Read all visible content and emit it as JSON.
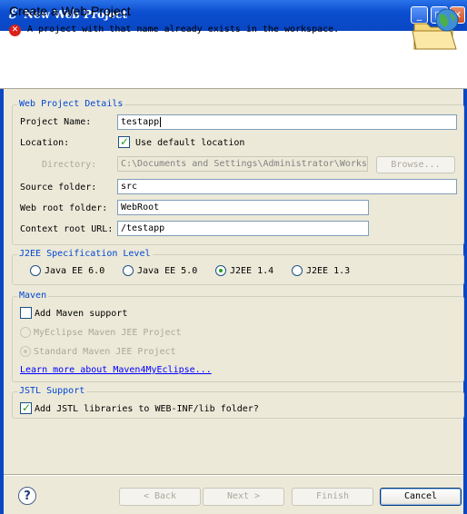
{
  "window": {
    "title": "New Web Project",
    "minimize_label": "_",
    "maximize_label": "□",
    "close_label": "✕"
  },
  "header": {
    "title": "Create a Web Project",
    "error_message": "A project with that name already exists in the workspace."
  },
  "details": {
    "group_label": "Web Project Details",
    "project_name_label": "Project Name:",
    "project_name_value": "testapp",
    "location_label": "Location:",
    "use_default_label": "Use default location",
    "use_default_checked": true,
    "directory_label": "Directory:",
    "directory_value": "C:\\Documents and Settings\\Administrator\\Works",
    "browse_label": "Browse...",
    "source_folder_label": "Source folder:",
    "source_folder_value": "src",
    "web_root_label": "Web root folder:",
    "web_root_value": "WebRoot",
    "context_root_label": "Context root URL:",
    "context_root_value": "/testapp"
  },
  "j2ee": {
    "group_label": "J2EE Specification Level",
    "options": [
      "Java EE 6.0",
      "Java EE 5.0",
      "J2EE 1.4",
      "J2EE 1.3"
    ],
    "selected": "J2EE 1.4"
  },
  "maven": {
    "group_label": "Maven",
    "add_support_label": "Add Maven support",
    "add_support_checked": false,
    "option_jee": "MyEclipse Maven JEE Project",
    "option_standard": "Standard Maven JEE Project",
    "learn_more": "Learn more about Maven4MyEclipse..."
  },
  "jstl": {
    "group_label": "JSTL Support",
    "add_jstl_label": "Add JSTL libraries to WEB-INF/lib folder?",
    "add_jstl_checked": true
  },
  "buttons": {
    "help": "?",
    "back": "< Back",
    "next": "Next >",
    "finish": "Finish",
    "cancel": "Cancel"
  },
  "colors": {
    "titlebar": "#0a47c4",
    "group_label": "#0046d5",
    "error_icon": "#d9221b",
    "link": "#0000ff"
  }
}
